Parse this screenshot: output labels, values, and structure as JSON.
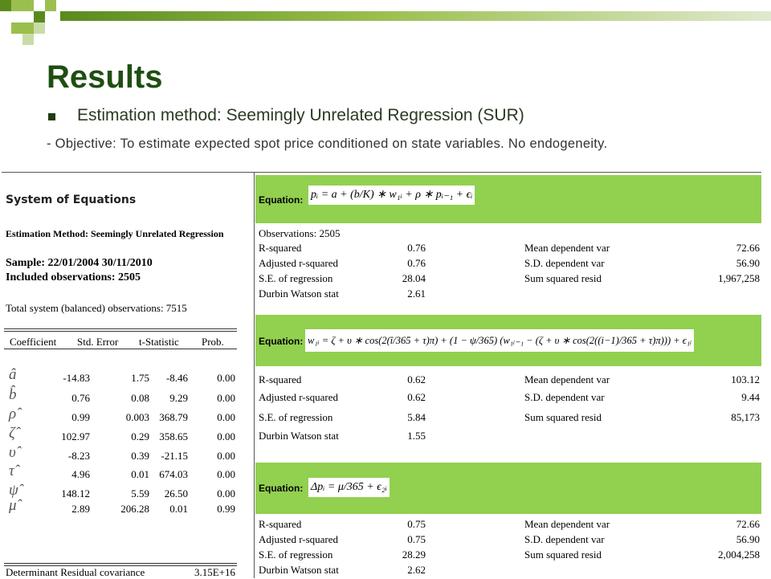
{
  "slide": {
    "title": "Results",
    "bullet": "Estimation method: Seemingly Unrelated Regression (SUR)",
    "objective": "- Objective: To estimate expected spot price conditioned on state variables. No endogeneity."
  },
  "colors": {
    "header_dark": "#1f4e12",
    "green_box": "#92d050",
    "header_light": "#9bbf4f"
  },
  "left": {
    "heading": "System of Equations",
    "method": "Estimation Method: Seemingly Unrelated Regression",
    "sample": "Sample: 22/01/2004 30/11/2010",
    "included": "Included observations: 2505",
    "total": "Total system (balanced) observations: 7515",
    "columns": [
      "Coefficient",
      "Std. Error",
      "t-Statistic",
      "Prob."
    ],
    "rows": [
      {
        "symbol": "â",
        "coef": "-14.83",
        "se": "1.75",
        "t": "-8.46",
        "p": "0.00"
      },
      {
        "symbol": "b̂",
        "coef": "0.76",
        "se": "0.08",
        "t": "9.29",
        "p": "0.00"
      },
      {
        "symbol": "ρ̂",
        "coef": "0.99",
        "se": "0.003",
        "t": "368.79",
        "p": "0.00"
      },
      {
        "symbol": "ζ̂",
        "coef": "102.97",
        "se": "0.29",
        "t": "358.65",
        "p": "0.00"
      },
      {
        "symbol": "υ̂",
        "coef": "-8.23",
        "se": "0.39",
        "t": "-21.15",
        "p": "0.00"
      },
      {
        "symbol": "τ̂",
        "coef": "4.96",
        "se": "0.01",
        "t": "674.03",
        "p": "0.00"
      },
      {
        "symbol": "ψ̂",
        "coef": "148.12",
        "se": "5.59",
        "t": "26.50",
        "p": "0.00"
      },
      {
        "symbol": "μ̂",
        "coef": "2.89",
        "se": "206.28",
        "t": "0.01",
        "p": "0.99"
      }
    ],
    "det_label": "Determinant Residual covariance",
    "det_value": "3.15E+16"
  },
  "equations": [
    {
      "label": "Equation:",
      "formula": "pᵢ = a + (b/K) ∗ w₁ᵢ + ρ ∗ pᵢ₋₁ + ϵᵢ",
      "observations": "Observations: 2505",
      "stats": [
        {
          "l": "R-squared",
          "v": "0.76",
          "l2": "Mean dependent var",
          "v2": "72.66"
        },
        {
          "l": "Adjusted r-squared",
          "v": "0.76",
          "l2": "S.D. dependent var",
          "v2": "56.90"
        },
        {
          "l": "S.E. of regression",
          "v": "28.04",
          "l2": "Sum squared resid",
          "v2": "1,967,258"
        },
        {
          "l": "Durbin Watson stat",
          "v": "2.61",
          "l2": "",
          "v2": ""
        }
      ]
    },
    {
      "label": "Equation:",
      "formula": "w₁ᵢ = ζ + υ ∗ cos(2(î/365 + τ)π) + (1 − ψ/365) (w₁ᵢ₋₁ − (ζ + υ ∗ cos(2((i−1)/365 + τ)π))) + ϵ₁ᵢ",
      "stats": [
        {
          "l": "R-squared",
          "v": "0.62",
          "l2": "Mean dependent var",
          "v2": "103.12"
        },
        {
          "l": "Adjusted r-squared",
          "v": "0.62",
          "l2": "S.D. dependent var",
          "v2": "9.44"
        },
        {
          "l": "S.E. of regression",
          "v": "5.84",
          "l2": "Sum squared resid",
          "v2": "85,173"
        },
        {
          "l": "Durbin Watson stat",
          "v": "1.55",
          "l2": "",
          "v2": ""
        }
      ]
    },
    {
      "label": "Equation:",
      "formula": "Δpᵢ = μ/365 + ϵ₂ᵢ",
      "stats": [
        {
          "l": "R-squared",
          "v": "0.75",
          "l2": "Mean dependent var",
          "v2": "72.66"
        },
        {
          "l": "Adjusted r-squared",
          "v": "0.75",
          "l2": "S.D. dependent var",
          "v2": "56.90"
        },
        {
          "l": "S.E. of regression",
          "v": "28.29",
          "l2": "Sum squared resid",
          "v2": "2,004,258"
        },
        {
          "l": "Durbin Watson stat",
          "v": "2.62",
          "l2": "",
          "v2": ""
        }
      ]
    }
  ]
}
